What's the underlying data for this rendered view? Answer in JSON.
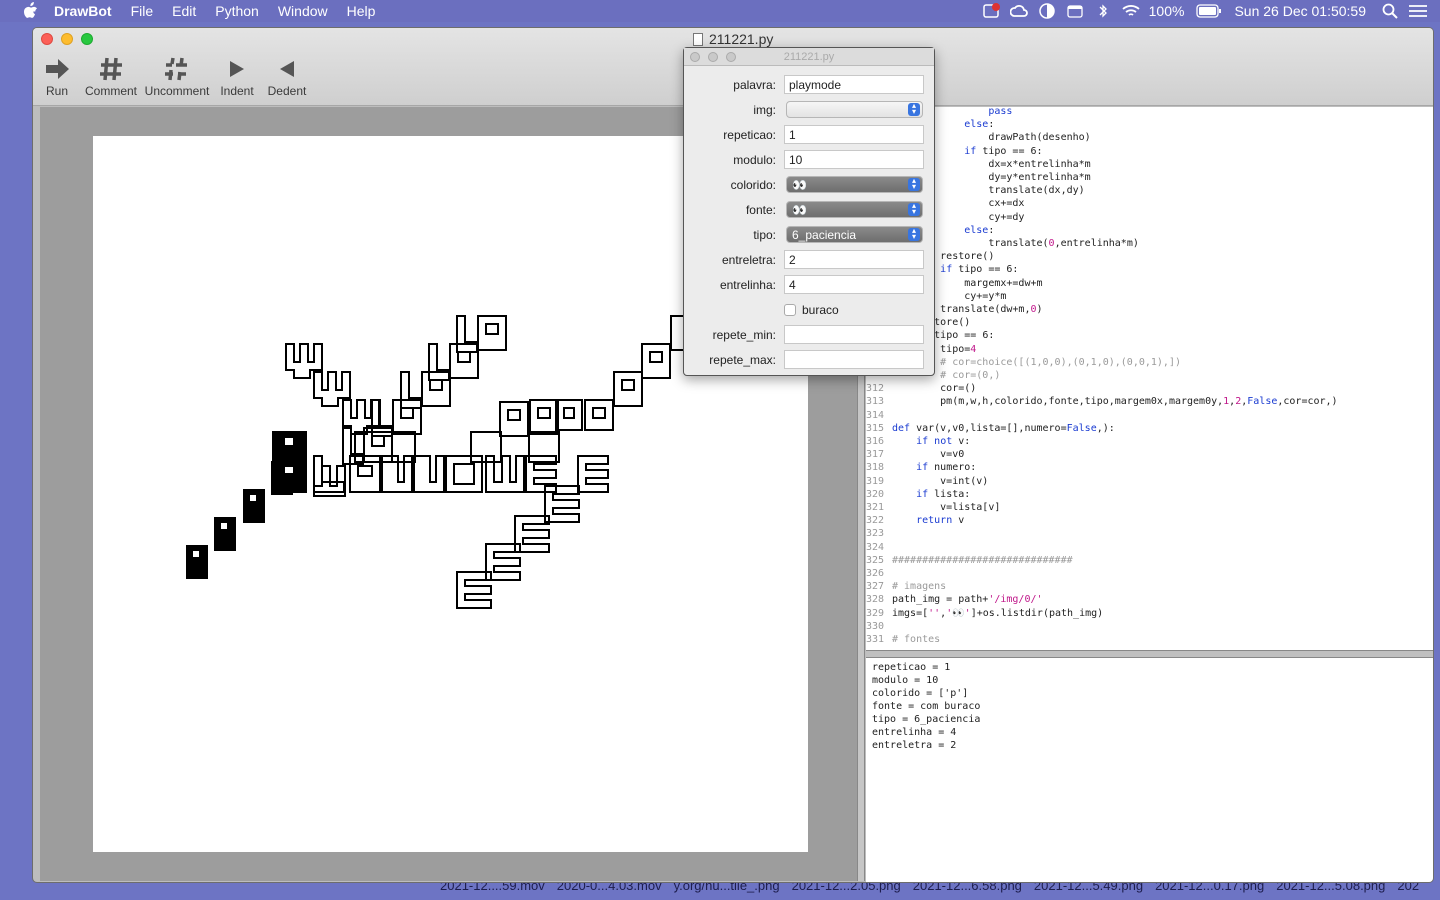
{
  "menubar": {
    "app_name": "DrawBot",
    "items": [
      "File",
      "Edit",
      "Python",
      "Window",
      "Help"
    ],
    "battery": "100%",
    "clock": "Sun 26 Dec  01:50:59"
  },
  "desktop_files": [
    "2021-12....59.mov",
    "2020-0...4.03.mov",
    "y.org/hu...tile_.png",
    "2021-12...2.05.png",
    "2021-12...6.58.png",
    "2021-12...5.49.png",
    "2021-12...0.17.png",
    "2021-12...5.08.png",
    "202"
  ],
  "window": {
    "title": "211221.py",
    "toolbar": {
      "run": "Run",
      "comment": "Comment",
      "uncomment": "Uncomment",
      "indent": "Indent",
      "dedent": "Dedent"
    }
  },
  "panel": {
    "title": "211221.py",
    "fields": {
      "palavra": {
        "label": "palavra:",
        "value": "playmode"
      },
      "img": {
        "label": "img:",
        "value": ""
      },
      "repeticao": {
        "label": "repeticao:",
        "value": "1"
      },
      "modulo": {
        "label": "modulo:",
        "value": "10"
      },
      "colorido": {
        "label": "colorido:",
        "value": "👀"
      },
      "fonte": {
        "label": "fonte:",
        "value": "👀"
      },
      "tipo": {
        "label": "tipo:",
        "value": "6_paciencia"
      },
      "entreletra": {
        "label": "entreletra:",
        "value": "2"
      },
      "entrelinha": {
        "label": "entrelinha:",
        "value": "4"
      },
      "buraco": {
        "label": "buraco"
      },
      "repete_min": {
        "label": "repete_min:",
        "value": ""
      },
      "repete_max": {
        "label": "repete_max:",
        "value": ""
      }
    }
  },
  "editor": {
    "lines": [
      {
        "n": "",
        "code": "                pass"
      },
      {
        "n": "",
        "code": "            else:"
      },
      {
        "n": "",
        "code": "                drawPath(desenho)"
      },
      {
        "n": "",
        "code": "            if tipo == 6:"
      },
      {
        "n": "",
        "code": "                dx=x*entrelinha*m"
      },
      {
        "n": "",
        "code": "                dy=y*entrelinha*m"
      },
      {
        "n": "",
        "code": "                translate(dx,dy)"
      },
      {
        "n": "",
        "code": "                cx+=dx"
      },
      {
        "n": "",
        "code": "                cy+=dy"
      },
      {
        "n": "",
        "code": "            else:"
      },
      {
        "n": "",
        "code": "                translate(0,entrelinha*m)"
      },
      {
        "n": "",
        "code": "        restore()"
      },
      {
        "n": "",
        "code": "        if tipo == 6:"
      },
      {
        "n": "",
        "code": "            margemx+=dw+m"
      },
      {
        "n": "",
        "code": "            cy+=y*m"
      },
      {
        "n": "",
        "code": "        translate(dw+m,0)"
      },
      {
        "n": "",
        "code": "    restore()"
      },
      {
        "n": "",
        "code": "    if tipo == 6:"
      },
      {
        "n": "",
        "code": "        tipo=4"
      },
      {
        "n": "",
        "code": "        # cor=choice([(1,0,0),(0,1,0),(0,0,1),])"
      },
      {
        "n": "",
        "code": "        # cor=(0,)"
      },
      {
        "n": "312",
        "code": "        cor=()"
      },
      {
        "n": "313",
        "code": "        pm(m,w,h,colorido,fonte,tipo,margem0x,margem0y,1,2,False,cor=cor,)"
      },
      {
        "n": "314",
        "code": ""
      },
      {
        "n": "315",
        "code": "def var(v,v0,lista=[],numero=False,):"
      },
      {
        "n": "316",
        "code": "    if not v:"
      },
      {
        "n": "317",
        "code": "        v=v0"
      },
      {
        "n": "318",
        "code": "    if numero:"
      },
      {
        "n": "319",
        "code": "        v=int(v)"
      },
      {
        "n": "320",
        "code": "    if lista:"
      },
      {
        "n": "321",
        "code": "        v=lista[v]"
      },
      {
        "n": "322",
        "code": "    return v"
      },
      {
        "n": "323",
        "code": ""
      },
      {
        "n": "324",
        "code": ""
      },
      {
        "n": "325",
        "code": "##############################"
      },
      {
        "n": "326",
        "code": ""
      },
      {
        "n": "327",
        "code": "# imagens"
      },
      {
        "n": "328",
        "code": "path_img = path+'/img/0/'"
      },
      {
        "n": "329",
        "code": "imgs=['','👀']+os.listdir(path_img)"
      },
      {
        "n": "330",
        "code": ""
      },
      {
        "n": "331",
        "code": "# fontes"
      }
    ]
  },
  "console": {
    "text": "repeticao = 1\nmodulo = 10\ncolorido = ['p']\nfonte = com buraco\ntipo = 6_paciencia\nentrelinha = 4\nentreletra = 2"
  }
}
